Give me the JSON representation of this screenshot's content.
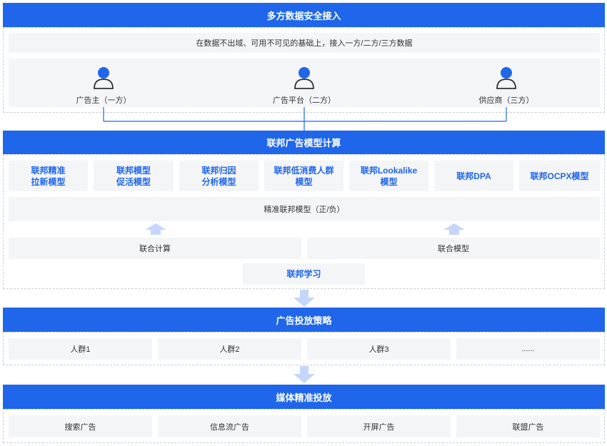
{
  "section1": {
    "title": "多方数据安全接入",
    "subtitle": "在数据不出域、可用不可见的基础上，接入一方/二方/三方数据",
    "parties": [
      {
        "label": "广告主（一方）",
        "icon": "person-icon"
      },
      {
        "label": "广告平台（二方）",
        "icon": "person-icon"
      },
      {
        "label": "供应商（三方）",
        "icon": "person-icon"
      }
    ]
  },
  "section2": {
    "title": "联邦广告模型计算",
    "models": [
      {
        "line1": "联邦精准",
        "line2": "拉新模型"
      },
      {
        "line1": "联邦模型",
        "line2": "促活模型"
      },
      {
        "line1": "联邦归因",
        "line2": "分析模型"
      },
      {
        "line1": "联邦低消费人群",
        "line2": "模型"
      },
      {
        "line1": "联邦Lookalike",
        "line2": "模型"
      },
      {
        "line1": "联邦DPA",
        "line2": ""
      },
      {
        "line1": "联邦OCPX模型",
        "line2": ""
      }
    ],
    "precise_model": "精准联邦模型（正/负）",
    "joint_compute": "联合计算",
    "joint_model": "联合模型",
    "federated_learning": "联邦学习"
  },
  "section3": {
    "title": "广告投放策略",
    "groups": [
      "人群1",
      "人群2",
      "人群3",
      "......"
    ]
  },
  "section4": {
    "title": "媒体精准投放",
    "channels": [
      "搜索广告",
      "信息流广告",
      "开屏广告",
      "联盟广告"
    ]
  },
  "colors": {
    "primary": "#1f66ea",
    "arrow": "#c4d6fb",
    "cell_bg": "#f4f5f7",
    "border": "#c8cdd6"
  }
}
